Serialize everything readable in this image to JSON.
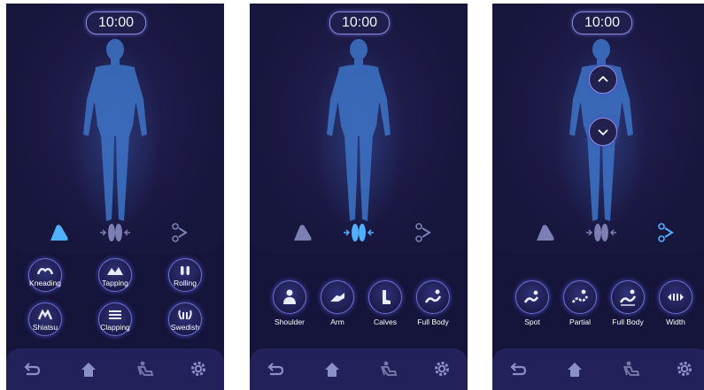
{
  "colors": {
    "background": "#15143a",
    "accent": "#4fb0ff",
    "icon_inactive": "#7b7fb3",
    "label": "#ffffff"
  },
  "screens": [
    {
      "timer": "10:00",
      "mode_tabs": [
        "foot-roller-icon",
        "foot-width-icon",
        "air-pressure-icon"
      ],
      "active_tab": 0,
      "buttons": [
        {
          "label": "Kneading",
          "icon": "kneading-icon"
        },
        {
          "label": "Tapping",
          "icon": "tapping-icon"
        },
        {
          "label": "Rolling",
          "icon": "rolling-icon"
        },
        {
          "label": "Shiatsu",
          "icon": "shiatsu-icon"
        },
        {
          "label": "Clapping",
          "icon": "clapping-icon"
        },
        {
          "label": "Swedish",
          "icon": "swedish-icon"
        }
      ],
      "nav": [
        "back-icon",
        "home-icon",
        "massage-chair-icon",
        "settings-icon"
      ]
    },
    {
      "timer": "10:00",
      "mode_tabs": [
        "foot-roller-icon",
        "foot-width-icon",
        "air-pressure-icon"
      ],
      "active_tab": 1,
      "buttons": [
        {
          "label": "Shoulder",
          "icon": "shoulder-icon"
        },
        {
          "label": "Arm",
          "icon": "arm-icon"
        },
        {
          "label": "Calves",
          "icon": "calves-icon"
        },
        {
          "label": "Full Body",
          "icon": "full-body-icon"
        }
      ],
      "nav": [
        "back-icon",
        "home-icon",
        "massage-chair-icon",
        "settings-icon"
      ]
    },
    {
      "timer": "10:00",
      "mode_tabs": [
        "foot-roller-icon",
        "foot-width-icon",
        "air-pressure-icon"
      ],
      "active_tab": 2,
      "body_arrows": [
        "chevron-up-icon",
        "chevron-down-icon"
      ],
      "buttons": [
        {
          "label": "Spot",
          "icon": "spot-icon"
        },
        {
          "label": "Partial",
          "icon": "partial-icon"
        },
        {
          "label": "Full Body",
          "icon": "full-body-icon"
        },
        {
          "label": "Width",
          "icon": "width-icon"
        }
      ],
      "nav": [
        "back-icon",
        "home-icon",
        "massage-chair-icon",
        "settings-icon"
      ]
    }
  ]
}
